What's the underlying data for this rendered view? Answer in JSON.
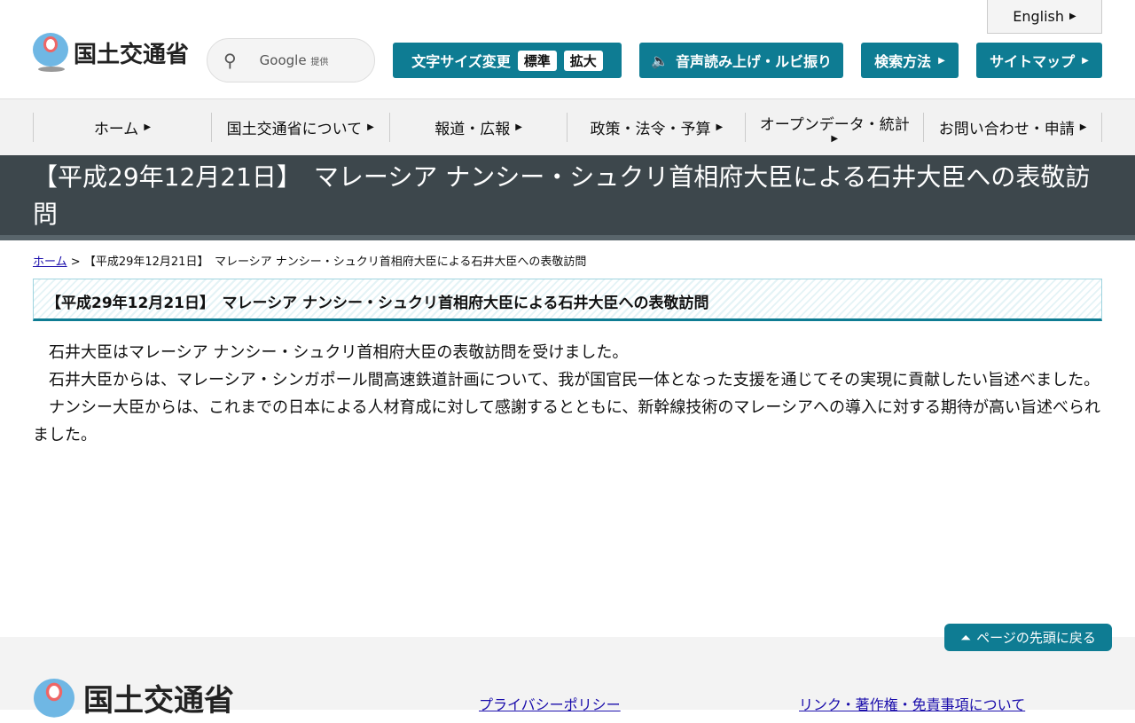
{
  "header": {
    "english": "English",
    "logo": "国土交通省",
    "search_provider": "Google",
    "search_provided": "提供",
    "font_size": "文字サイズ変更",
    "font_standard": "標準",
    "font_large": "拡大",
    "speech": "音声読み上げ・ルビ振り",
    "search_method": "検索方法",
    "sitemap": "サイトマップ"
  },
  "nav": [
    "ホーム",
    "国土交通省について",
    "報道・広報",
    "政策・法令・予算",
    "オープンデータ・統計",
    "お問い合わせ・申請"
  ],
  "title": "【平成29年12月21日】　マレーシア ナンシー・シュクリ首相府大臣による石井大臣への表敬訪問",
  "breadcrumb": {
    "home": "ホーム",
    "sep": ">",
    "current": "【平成29年12月21日】　マレーシア ナンシー・シュクリ首相府大臣による石井大臣への表敬訪問"
  },
  "heading": "【平成29年12月21日】　マレーシア ナンシー・シュクリ首相府大臣による石井大臣への表敬訪問",
  "paragraphs": [
    "　石井大臣はマレーシア ナンシー・シュクリ首相府大臣の表敬訪問を受けました。",
    "　石井大臣からは、マレーシア・シンガポール間高速鉄道計画について、我が国官民一体となった支援を通じてその実現に貢献したい旨述べました。",
    "　ナンシー大臣からは、これまでの日本による人材育成に対して感謝するとともに、新幹線技術のマレーシアへの導入に対する期待が高い旨述べられました。"
  ],
  "footer": {
    "back_to_top": "ページの先頭に戻る",
    "logo": "国土交通省",
    "privacy": "プライバシーポリシー",
    "links": "リンク・著作権・免責事項について"
  },
  "colors": {
    "accent": "#0e7c93",
    "title_band": "#3d474c"
  }
}
